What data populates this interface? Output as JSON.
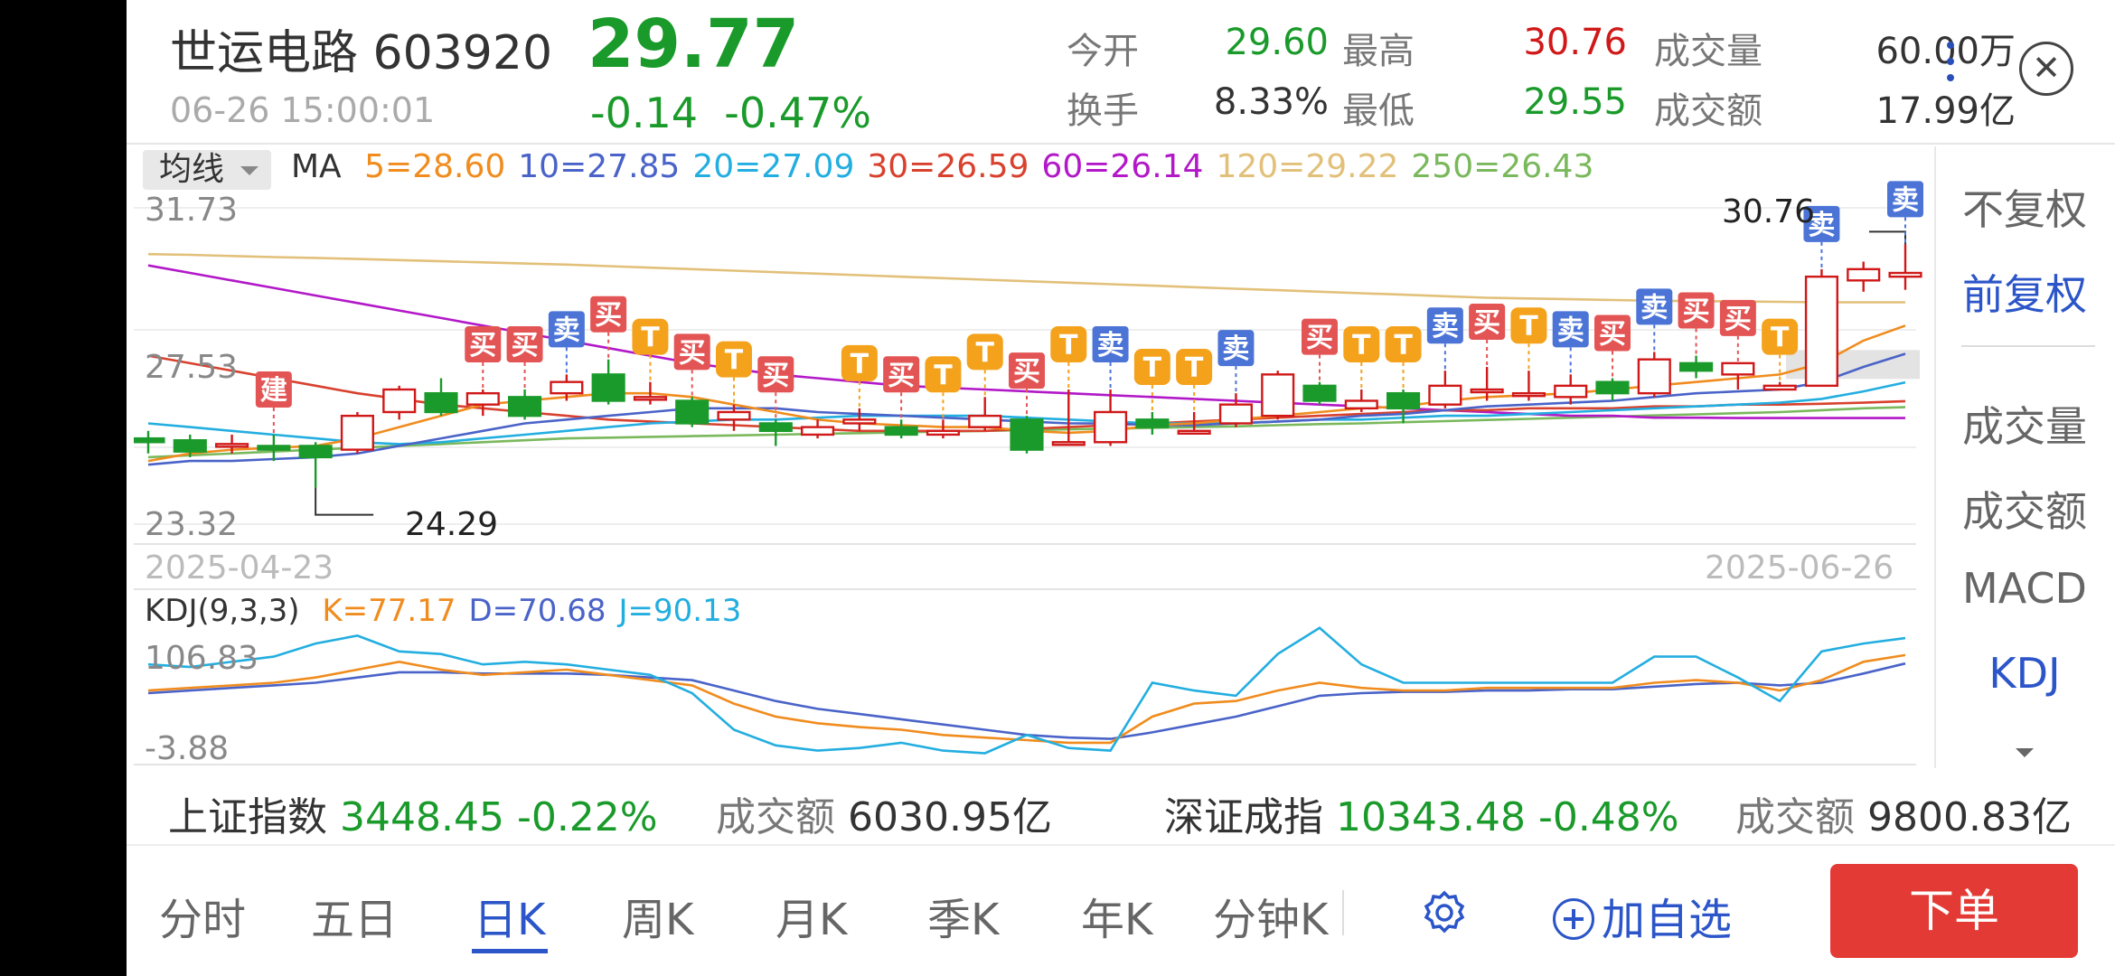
{
  "header": {
    "stock_name": "世运电路 603920",
    "price": "29.77",
    "timestamp": "06-26 15:00:01",
    "change": "-0.14",
    "change_pct": "-0.47%",
    "stats": [
      {
        "label": "今开",
        "value": "29.60",
        "color": "green"
      },
      {
        "label": "最高",
        "value": "30.76",
        "color": "red"
      },
      {
        "label": "成交量",
        "value": "60.00万",
        "color": "dark"
      },
      {
        "label": "换手",
        "value": "8.33%",
        "color": "dark"
      },
      {
        "label": "最低",
        "value": "29.55",
        "color": "green"
      },
      {
        "label": "成交额",
        "value": "17.99亿",
        "color": "dark"
      }
    ]
  },
  "ma_legend": {
    "dropdown_label": "均线",
    "title": "MA",
    "items": [
      {
        "text": "5=28.60",
        "color": "#f08c1e"
      },
      {
        "text": "10=27.85",
        "color": "#4a63c8"
      },
      {
        "text": "20=27.09",
        "color": "#23aee0"
      },
      {
        "text": "30=26.59",
        "color": "#d8412e"
      },
      {
        "text": "60=26.14",
        "color": "#b218c8"
      },
      {
        "text": "120=29.22",
        "color": "#e2c07a"
      },
      {
        "text": "250=26.43",
        "color": "#7ab85c"
      }
    ]
  },
  "price_axis": {
    "top": "31.73",
    "mid": "27.53",
    "bottom": "23.32"
  },
  "annotations": {
    "high": "30.76",
    "low": "24.29"
  },
  "dates": {
    "start": "2025-04-23",
    "end": "2025-06-26"
  },
  "kdj_legend": {
    "title": "KDJ(9,3,3)",
    "items": [
      {
        "text": "K=77.17",
        "color": "#f08c1e"
      },
      {
        "text": "D=70.68",
        "color": "#4a63c8"
      },
      {
        "text": "J=90.13",
        "color": "#23aee0"
      }
    ]
  },
  "kdj_axis": {
    "top": "106.83",
    "bottom": "-3.88"
  },
  "right_panel": [
    "不复权",
    "前复权",
    "成交量",
    "成交额",
    "MACD",
    "KDJ"
  ],
  "index_bar": {
    "sh_name": "上证指数",
    "sh_value": "3448.45",
    "sh_pct": "-0.22%",
    "sh_amt_label": "成交额",
    "sh_amt": "6030.95亿",
    "sz_name": "深证成指",
    "sz_value": "10343.48",
    "sz_pct": "-0.48%",
    "sz_amt_label": "成交额",
    "sz_amt": "9800.83亿"
  },
  "tabs": [
    "分时",
    "五日",
    "日K",
    "周K",
    "月K",
    "季K",
    "年K",
    "分钟K"
  ],
  "add_favorite": "加自选",
  "order_button": "下单",
  "colors": {
    "up": "#d01818",
    "down": "#1a9a2a",
    "accent": "#2b55c8",
    "order": "#e33a35"
  },
  "chart_data": {
    "type": "candlestick",
    "title": "",
    "ylim": [
      23.32,
      31.73
    ],
    "x_range": [
      "2025-04-23",
      "2025-06-26"
    ],
    "candles": [
      {
        "o": 25.6,
        "c": 25.5,
        "h": 25.8,
        "l": 25.2
      },
      {
        "o": 25.55,
        "c": 25.25,
        "h": 25.7,
        "l": 25.1
      },
      {
        "o": 25.4,
        "c": 25.45,
        "h": 25.7,
        "l": 25.2
      },
      {
        "o": 25.4,
        "c": 25.3,
        "h": 25.7,
        "l": 25.0
      },
      {
        "o": 25.4,
        "c": 25.1,
        "h": 25.5,
        "l": 24.29
      },
      {
        "o": 25.3,
        "c": 26.2,
        "h": 26.3,
        "l": 25.2
      },
      {
        "o": 26.3,
        "c": 26.9,
        "h": 27.0,
        "l": 26.1
      },
      {
        "o": 26.8,
        "c": 26.3,
        "h": 27.2,
        "l": 26.2
      },
      {
        "o": 26.5,
        "c": 26.8,
        "h": 26.9,
        "l": 26.2
      },
      {
        "o": 26.7,
        "c": 26.2,
        "h": 26.9,
        "l": 26.1
      },
      {
        "o": 26.8,
        "c": 27.1,
        "h": 27.3,
        "l": 26.6
      },
      {
        "o": 27.3,
        "c": 26.6,
        "h": 27.7,
        "l": 26.5
      },
      {
        "o": 26.7,
        "c": 26.7,
        "h": 27.1,
        "l": 26.5
      },
      {
        "o": 26.6,
        "c": 26.0,
        "h": 26.7,
        "l": 25.9
      },
      {
        "o": 26.1,
        "c": 26.3,
        "h": 26.5,
        "l": 25.8
      },
      {
        "o": 26.0,
        "c": 25.8,
        "h": 26.1,
        "l": 25.4
      },
      {
        "o": 25.7,
        "c": 25.9,
        "h": 26.1,
        "l": 25.6
      },
      {
        "o": 26.0,
        "c": 26.1,
        "h": 26.4,
        "l": 25.8
      },
      {
        "o": 25.9,
        "c": 25.7,
        "h": 26.1,
        "l": 25.6
      },
      {
        "o": 25.7,
        "c": 25.8,
        "h": 26.1,
        "l": 25.6
      },
      {
        "o": 25.9,
        "c": 26.2,
        "h": 26.7,
        "l": 25.8
      },
      {
        "o": 26.1,
        "c": 25.3,
        "h": 26.2,
        "l": 25.2
      },
      {
        "o": 25.5,
        "c": 25.5,
        "h": 26.9,
        "l": 25.4
      },
      {
        "o": 25.5,
        "c": 26.3,
        "h": 26.9,
        "l": 25.4
      },
      {
        "o": 26.1,
        "c": 25.9,
        "h": 26.3,
        "l": 25.7
      },
      {
        "o": 25.8,
        "c": 25.8,
        "h": 26.3,
        "l": 25.7
      },
      {
        "o": 26.0,
        "c": 26.5,
        "h": 26.8,
        "l": 25.9
      },
      {
        "o": 26.2,
        "c": 27.3,
        "h": 27.4,
        "l": 26.1
      },
      {
        "o": 27.0,
        "c": 26.6,
        "h": 27.1,
        "l": 26.5
      },
      {
        "o": 26.4,
        "c": 26.6,
        "h": 26.9,
        "l": 26.3
      },
      {
        "o": 26.8,
        "c": 26.4,
        "h": 26.9,
        "l": 26.0
      },
      {
        "o": 26.5,
        "c": 27.0,
        "h": 27.4,
        "l": 26.4
      },
      {
        "o": 26.9,
        "c": 26.9,
        "h": 27.5,
        "l": 26.6
      },
      {
        "o": 26.8,
        "c": 26.8,
        "h": 27.4,
        "l": 26.6
      },
      {
        "o": 26.7,
        "c": 27.0,
        "h": 27.3,
        "l": 26.5
      },
      {
        "o": 27.1,
        "c": 26.8,
        "h": 27.2,
        "l": 26.6
      },
      {
        "o": 26.8,
        "c": 27.7,
        "h": 27.9,
        "l": 26.7
      },
      {
        "o": 27.6,
        "c": 27.4,
        "h": 27.8,
        "l": 27.2
      },
      {
        "o": 27.3,
        "c": 27.6,
        "h": 27.6,
        "l": 26.9
      },
      {
        "o": 26.9,
        "c": 27.0,
        "h": 27.1,
        "l": 26.9
      },
      {
        "o": 27.0,
        "c": 29.9,
        "h": 30.1,
        "l": 27.0
      },
      {
        "o": 29.8,
        "c": 30.1,
        "h": 30.3,
        "l": 29.5
      },
      {
        "o": 29.9,
        "c": 30.0,
        "h": 30.76,
        "l": 29.55
      }
    ],
    "ma_lines": [
      {
        "name": "MA5",
        "values": [
          25.0,
          25.2,
          25.3,
          25.35,
          25.4,
          25.6,
          25.9,
          26.2,
          26.5,
          26.6,
          26.7,
          26.8,
          26.8,
          26.7,
          26.5,
          26.3,
          26.1,
          26.0,
          25.95,
          25.9,
          25.9,
          25.8,
          25.75,
          25.8,
          25.95,
          26.0,
          26.1,
          26.2,
          26.3,
          26.4,
          26.45,
          26.6,
          26.7,
          26.75,
          26.8,
          26.9,
          27.0,
          27.1,
          27.2,
          27.3,
          27.6,
          28.2,
          28.6
        ]
      },
      {
        "name": "MA10",
        "values": [
          24.9,
          25.0,
          25.0,
          25.05,
          25.1,
          25.2,
          25.4,
          25.6,
          25.8,
          26.0,
          26.1,
          26.2,
          26.3,
          26.4,
          26.4,
          26.4,
          26.3,
          26.25,
          26.2,
          26.15,
          26.1,
          26.05,
          26.0,
          26.0,
          25.95,
          25.95,
          26.0,
          26.05,
          26.1,
          26.2,
          26.25,
          26.35,
          26.45,
          26.5,
          26.55,
          26.6,
          26.7,
          26.8,
          26.85,
          26.9,
          27.1,
          27.5,
          27.85
        ]
      },
      {
        "name": "MA20",
        "values": [
          26.0,
          25.9,
          25.8,
          25.7,
          25.6,
          25.5,
          25.45,
          25.5,
          25.6,
          25.7,
          25.8,
          25.9,
          26.0,
          26.05,
          26.1,
          26.1,
          26.15,
          26.2,
          26.2,
          26.2,
          26.2,
          26.15,
          26.1,
          26.05,
          26.0,
          26.0,
          26.0,
          26.05,
          26.1,
          26.1,
          26.15,
          26.2,
          26.2,
          26.25,
          26.3,
          26.35,
          26.4,
          26.45,
          26.5,
          26.55,
          26.65,
          26.85,
          27.09
        ]
      },
      {
        "name": "MA30",
        "values": [
          27.8,
          27.6,
          27.4,
          27.2,
          27.0,
          26.8,
          26.65,
          26.5,
          26.4,
          26.3,
          26.2,
          26.1,
          26.05,
          26.0,
          25.95,
          25.9,
          25.85,
          25.8,
          25.8,
          25.8,
          25.8,
          25.85,
          25.9,
          25.95,
          26.0,
          26.05,
          26.1,
          26.15,
          26.2,
          26.25,
          26.3,
          26.35,
          26.35,
          26.4,
          26.4,
          26.4,
          26.45,
          26.45,
          26.5,
          26.5,
          26.52,
          26.55,
          26.59
        ]
      },
      {
        "name": "MA60",
        "values": [
          30.2,
          30.0,
          29.8,
          29.6,
          29.4,
          29.2,
          29.0,
          28.8,
          28.6,
          28.4,
          28.2,
          28.0,
          27.8,
          27.6,
          27.45,
          27.3,
          27.2,
          27.1,
          27.0,
          26.95,
          26.9,
          26.85,
          26.8,
          26.75,
          26.7,
          26.65,
          26.6,
          26.55,
          26.5,
          26.45,
          26.4,
          26.35,
          26.3,
          26.25,
          26.2,
          26.2,
          26.15,
          26.15,
          26.14,
          26.14,
          26.14,
          26.14,
          26.14
        ]
      },
      {
        "name": "MA120",
        "values": [
          30.5,
          30.48,
          30.45,
          30.42,
          30.4,
          30.37,
          30.34,
          30.31,
          30.28,
          30.25,
          30.22,
          30.18,
          30.14,
          30.1,
          30.06,
          30.02,
          29.98,
          29.94,
          29.9,
          29.86,
          29.82,
          29.78,
          29.74,
          29.7,
          29.66,
          29.62,
          29.58,
          29.54,
          29.5,
          29.46,
          29.42,
          29.38,
          29.34,
          29.32,
          29.3,
          29.28,
          29.26,
          29.25,
          29.24,
          29.23,
          29.22,
          29.22,
          29.22
        ]
      },
      {
        "name": "MA250",
        "values": [
          25.1,
          25.15,
          25.2,
          25.25,
          25.3,
          25.35,
          25.4,
          25.45,
          25.5,
          25.55,
          25.6,
          25.62,
          25.64,
          25.66,
          25.68,
          25.7,
          25.72,
          25.74,
          25.76,
          25.78,
          25.8,
          25.82,
          25.84,
          25.86,
          25.88,
          25.9,
          25.92,
          25.95,
          25.98,
          26.0,
          26.03,
          26.06,
          26.09,
          26.12,
          26.15,
          26.18,
          26.21,
          26.24,
          26.27,
          26.3,
          26.35,
          26.4,
          26.43
        ]
      }
    ],
    "kdj": {
      "ylim": [
        -3.88,
        106.83
      ],
      "K": [
        50,
        52,
        54,
        56,
        60,
        66,
        72,
        66,
        62,
        64,
        66,
        62,
        58,
        54,
        40,
        30,
        25,
        22,
        20,
        16,
        14,
        12,
        10,
        10,
        30,
        40,
        42,
        50,
        56,
        52,
        50,
        50,
        52,
        52,
        52,
        52,
        56,
        58,
        56,
        50,
        58,
        72,
        77.17
      ],
      "D": [
        48,
        50,
        52,
        54,
        56,
        60,
        64,
        64,
        63,
        63,
        63,
        62,
        60,
        58,
        50,
        42,
        36,
        32,
        28,
        24,
        20,
        16,
        14,
        13,
        18,
        24,
        30,
        38,
        46,
        48,
        49,
        49,
        50,
        50,
        51,
        51,
        53,
        55,
        56,
        54,
        56,
        63,
        70.68
      ],
      "J": [
        70,
        68,
        72,
        76,
        86,
        92,
        80,
        78,
        70,
        72,
        70,
        66,
        62,
        48,
        20,
        8,
        4,
        6,
        10,
        4,
        2,
        16,
        6,
        4,
        56,
        50,
        46,
        78,
        98,
        70,
        56,
        56,
        56,
        56,
        56,
        56,
        76,
        76,
        60,
        42,
        80,
        86,
        90.13
      ]
    },
    "signals": [
      {
        "i": 3,
        "text": "建"
      },
      {
        "i": 8,
        "text": "买"
      },
      {
        "i": 9,
        "text": "买"
      },
      {
        "i": 10,
        "text": "卖"
      },
      {
        "i": 11,
        "text": "买"
      },
      {
        "i": 12,
        "text": "T"
      },
      {
        "i": 13,
        "text": "买"
      },
      {
        "i": 14,
        "text": "T"
      },
      {
        "i": 15,
        "text": "买"
      },
      {
        "i": 17,
        "text": "T"
      },
      {
        "i": 18,
        "text": "买"
      },
      {
        "i": 19,
        "text": "T"
      },
      {
        "i": 20,
        "text": "T"
      },
      {
        "i": 21,
        "text": "买"
      },
      {
        "i": 22,
        "text": "T"
      },
      {
        "i": 23,
        "text": "卖"
      },
      {
        "i": 24,
        "text": "T"
      },
      {
        "i": 25,
        "text": "T"
      },
      {
        "i": 26,
        "text": "卖"
      },
      {
        "i": 28,
        "text": "买"
      },
      {
        "i": 29,
        "text": "T"
      },
      {
        "i": 30,
        "text": "T"
      },
      {
        "i": 31,
        "text": "卖"
      },
      {
        "i": 32,
        "text": "买"
      },
      {
        "i": 33,
        "text": "T"
      },
      {
        "i": 34,
        "text": "卖"
      },
      {
        "i": 35,
        "text": "买"
      },
      {
        "i": 36,
        "text": "卖"
      },
      {
        "i": 37,
        "text": "买"
      },
      {
        "i": 38,
        "text": "买"
      },
      {
        "i": 39,
        "text": "T"
      },
      {
        "i": 40,
        "text": "卖"
      },
      {
        "i": 42,
        "text": "卖"
      }
    ]
  }
}
